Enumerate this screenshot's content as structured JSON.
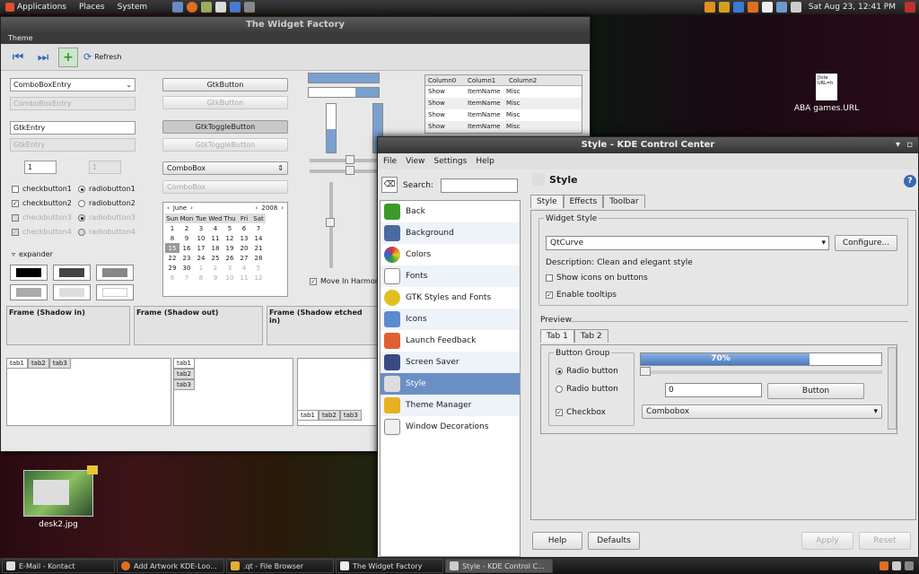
{
  "top_panel": {
    "apps": "Applications",
    "places": "Places",
    "system": "System",
    "clock": "Sat Aug 23, 12:41 PM"
  },
  "desktop": {
    "file1_label": "ABA games.URL",
    "file1_thumb": "[Inte\nURL=h",
    "file2_label": "desk2.jpg"
  },
  "widget_factory": {
    "title": "The Widget Factory",
    "menu": "Theme",
    "refresh": "Refresh",
    "combo_entry": "ComboBoxEntry",
    "combo_entry_dis": "ComboBoxEntry",
    "entry": "GtkEntry",
    "entry_dis": "GtkEntry",
    "spin1": "1",
    "spin2": "1",
    "checks": [
      "checkbutton1",
      "checkbutton2",
      "checkbutton3",
      "checkbutton4"
    ],
    "radios": [
      "radiobutton1",
      "radiobutton2",
      "radiobutton3",
      "radiobutton4"
    ],
    "expander": "expander",
    "button": "GtkButton",
    "button_dis": "GtkButton",
    "toggle": "GtkToggleButton",
    "toggle_dis": "GtkToggleButton",
    "combobox": "ComboBox",
    "combobox_dis": "ComboBox",
    "calendar": {
      "month": "June",
      "year": "2008",
      "days": [
        "Sun",
        "Mon",
        "Tue",
        "Wed",
        "Thu",
        "Fri",
        "Sat"
      ],
      "weeks": [
        [
          "1",
          "2",
          "3",
          "4",
          "5",
          "6",
          "7"
        ],
        [
          "8",
          "9",
          "10",
          "11",
          "12",
          "13",
          "14"
        ],
        [
          "15",
          "16",
          "17",
          "18",
          "19",
          "20",
          "21"
        ],
        [
          "22",
          "23",
          "24",
          "25",
          "26",
          "27",
          "28"
        ],
        [
          "29",
          "30",
          "1",
          "2",
          "3",
          "4",
          "5"
        ],
        [
          "6",
          "7",
          "8",
          "9",
          "10",
          "11",
          "12"
        ]
      ]
    },
    "move_harmony": "Move In Harmony",
    "tree": {
      "columns": [
        "Column0",
        "Column1",
        "Column2"
      ],
      "rows": [
        [
          "Show",
          "ItemName",
          "Misc"
        ],
        [
          "Show",
          "ItemName",
          "Misc"
        ],
        [
          "Show",
          "ItemName",
          "Misc"
        ],
        [
          "Show",
          "ItemName",
          "Misc"
        ]
      ]
    },
    "frames": [
      "Frame (Shadow in)",
      "Frame (Shadow out)",
      "Frame (Shadow etched in)"
    ],
    "tabs": [
      "tab1",
      "tab2",
      "tab3"
    ]
  },
  "kde": {
    "title": "Style - KDE Control Center",
    "menu": [
      "File",
      "View",
      "Settings",
      "Help"
    ],
    "search_label": "Search:",
    "modules": [
      "Back",
      "Background",
      "Colors",
      "Fonts",
      "GTK Styles and Fonts",
      "Icons",
      "Launch Feedback",
      "Screen Saver",
      "Style",
      "Theme Manager",
      "Window Decorations"
    ],
    "heading": "Style",
    "tabs": [
      "Style",
      "Effects",
      "Toolbar"
    ],
    "widget_style_group": "Widget Style",
    "widget_style": "QtCurve",
    "configure": "Configure...",
    "description": "Description: Clean and elegant style",
    "show_icons": "Show icons on buttons",
    "enable_tooltips": "Enable tooltips",
    "preview": "Preview",
    "preview_tabs": [
      "Tab 1",
      "Tab 2"
    ],
    "button_group": "Button Group",
    "radio1": "Radio button",
    "radio2": "Radio button",
    "checkbox": "Checkbox",
    "progress": 0.7,
    "progress_label": "70%",
    "spin_value": "0",
    "button": "Button",
    "combobox": "Combobox",
    "help": "Help",
    "defaults": "Defaults",
    "apply": "Apply",
    "reset": "Reset"
  },
  "taskbar": [
    "E-Mail - Kontact",
    "Add Artwork KDE-Loo...",
    ".qt - File Browser",
    "The Widget Factory",
    "Style - KDE Control C..."
  ]
}
